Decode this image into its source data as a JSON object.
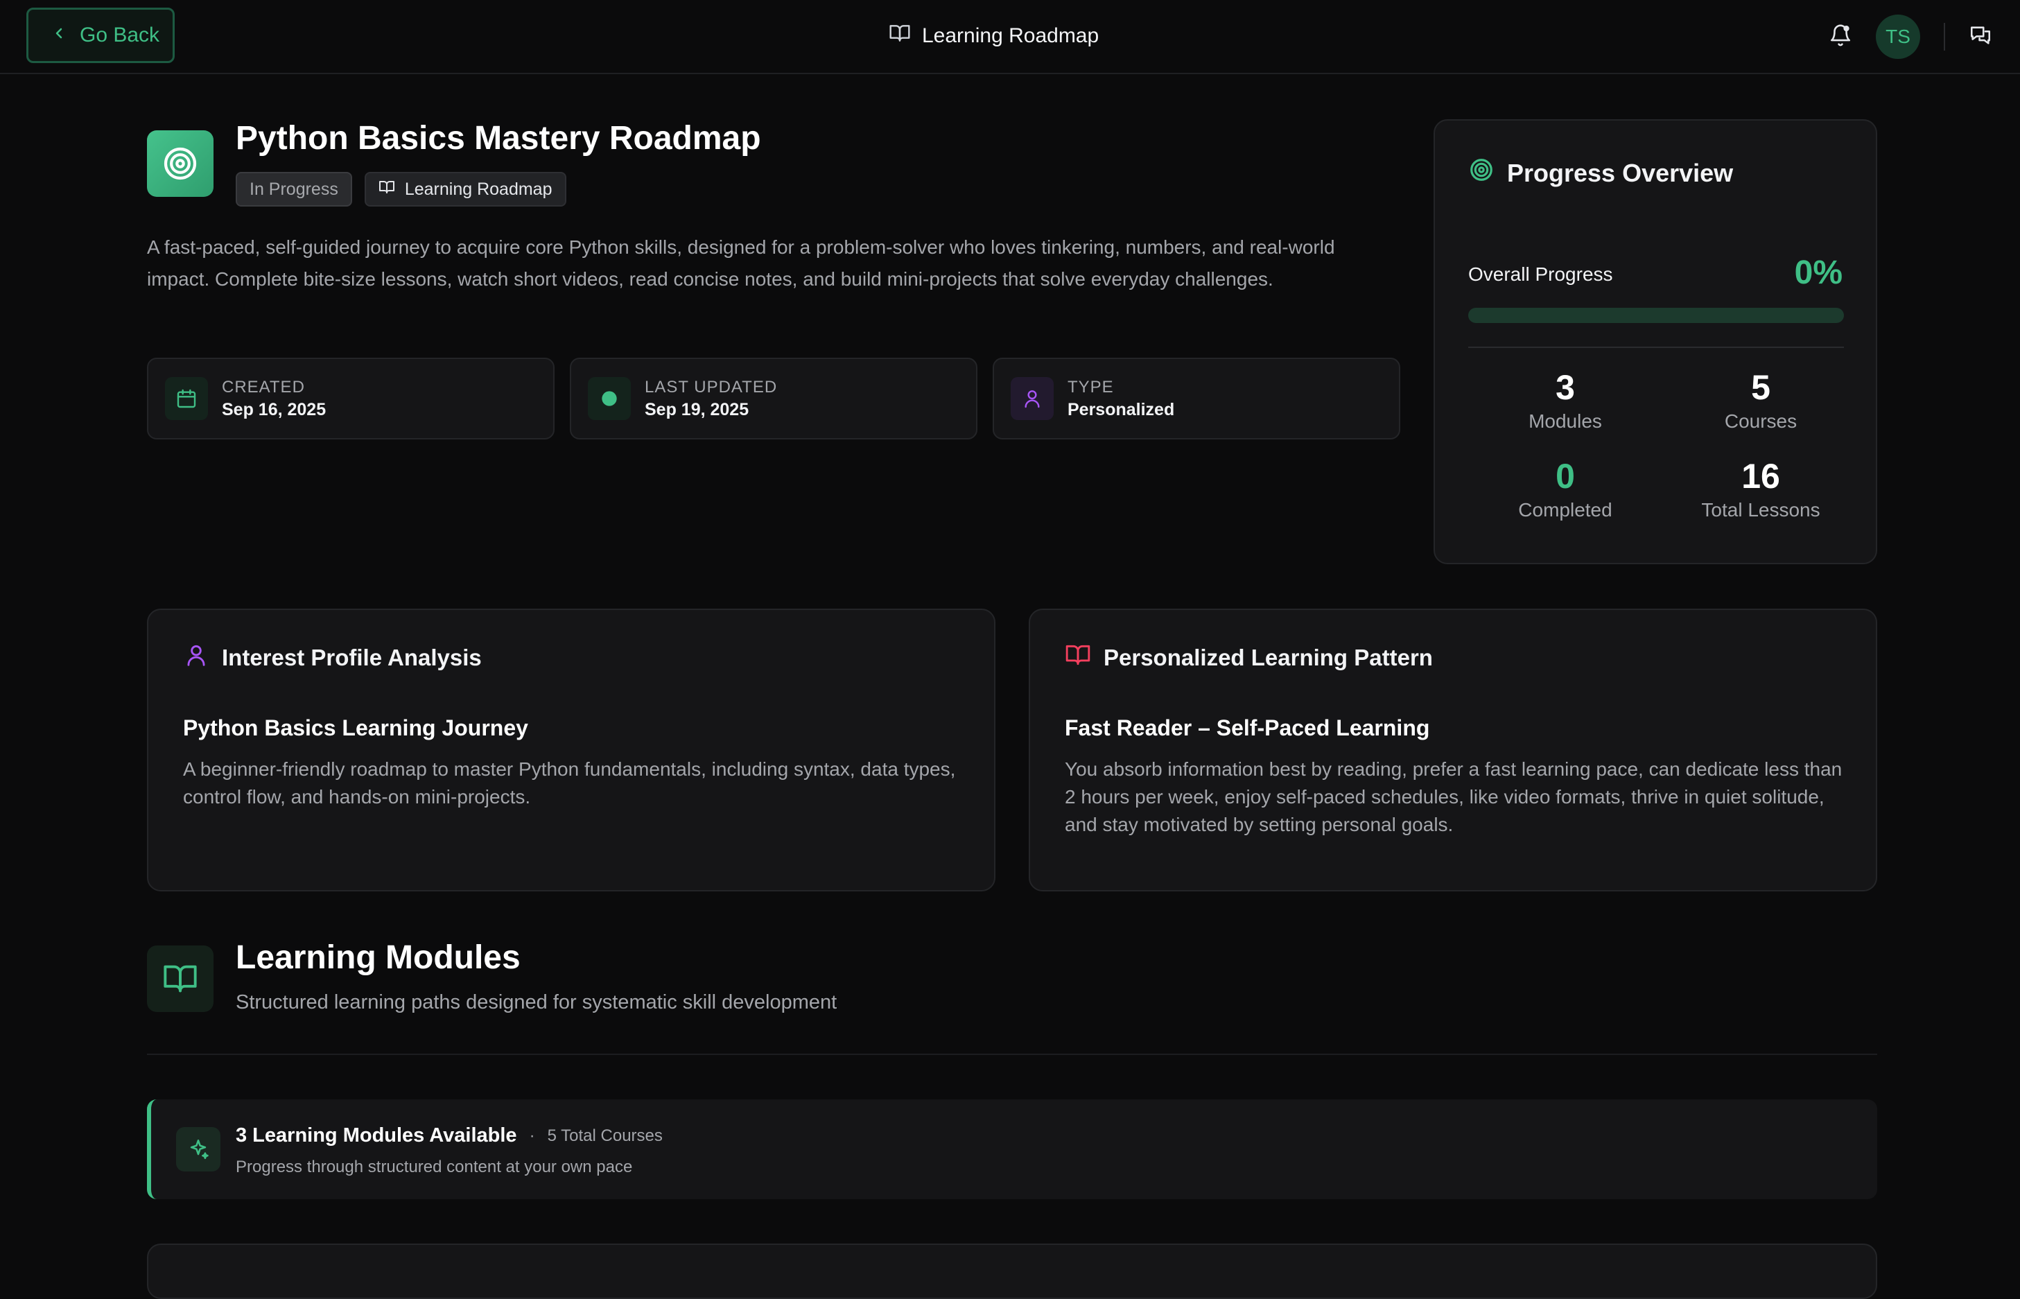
{
  "header": {
    "back_label": "Go Back",
    "title": "Learning Roadmap",
    "avatar_initials": "TS"
  },
  "roadmap": {
    "title": "Python Basics Mastery Roadmap",
    "status_badge": "In Progress",
    "type_badge": "Learning Roadmap",
    "description": "A fast-paced, self-guided journey to acquire core Python skills, designed for a problem-solver who loves tinkering, numbers, and real-world impact. Complete bite-size lessons, watch short videos, read concise notes, and build mini-projects that solve everyday challenges."
  },
  "meta": [
    {
      "label": "CREATED",
      "value": "Sep 16, 2025"
    },
    {
      "label": "LAST UPDATED",
      "value": "Sep 19, 2025"
    },
    {
      "label": "TYPE",
      "value": "Personalized"
    }
  ],
  "progress": {
    "heading": "Progress Overview",
    "overall_label": "Overall Progress",
    "overall_value": "0%",
    "overall_fraction": 0,
    "stats": [
      {
        "value": "3",
        "label": "Modules"
      },
      {
        "value": "5",
        "label": "Courses"
      },
      {
        "value": "0",
        "label": "Completed"
      },
      {
        "value": "16",
        "label": "Total Lessons"
      }
    ]
  },
  "interest": {
    "heading": "Interest Profile Analysis",
    "subtitle": "Python Basics Learning Journey",
    "description": "A beginner-friendly roadmap to master Python fundamentals, including syntax, data types, control flow, and hands-on mini-projects."
  },
  "pattern": {
    "heading": "Personalized Learning Pattern",
    "subtitle": "Fast Reader – Self-Paced Learning",
    "description": "You absorb information best by reading, prefer a fast learning pace, can dedicate less than 2 hours per week, enjoy self-paced schedules, like video formats, thrive in quiet solitude, and stay motivated by setting personal goals."
  },
  "modules": {
    "title": "Learning Modules",
    "subtitle": "Structured learning paths designed for systematic skill development",
    "available_title": "3 Learning Modules Available",
    "separator": "·",
    "total_courses": "5 Total Courses",
    "available_sub": "Progress through structured content at your own pace"
  },
  "colors": {
    "accent": "#3fbf86",
    "background": "#0b0b0c",
    "card": "#151517",
    "purple": "#a855f7",
    "pink": "#f43f5e"
  }
}
